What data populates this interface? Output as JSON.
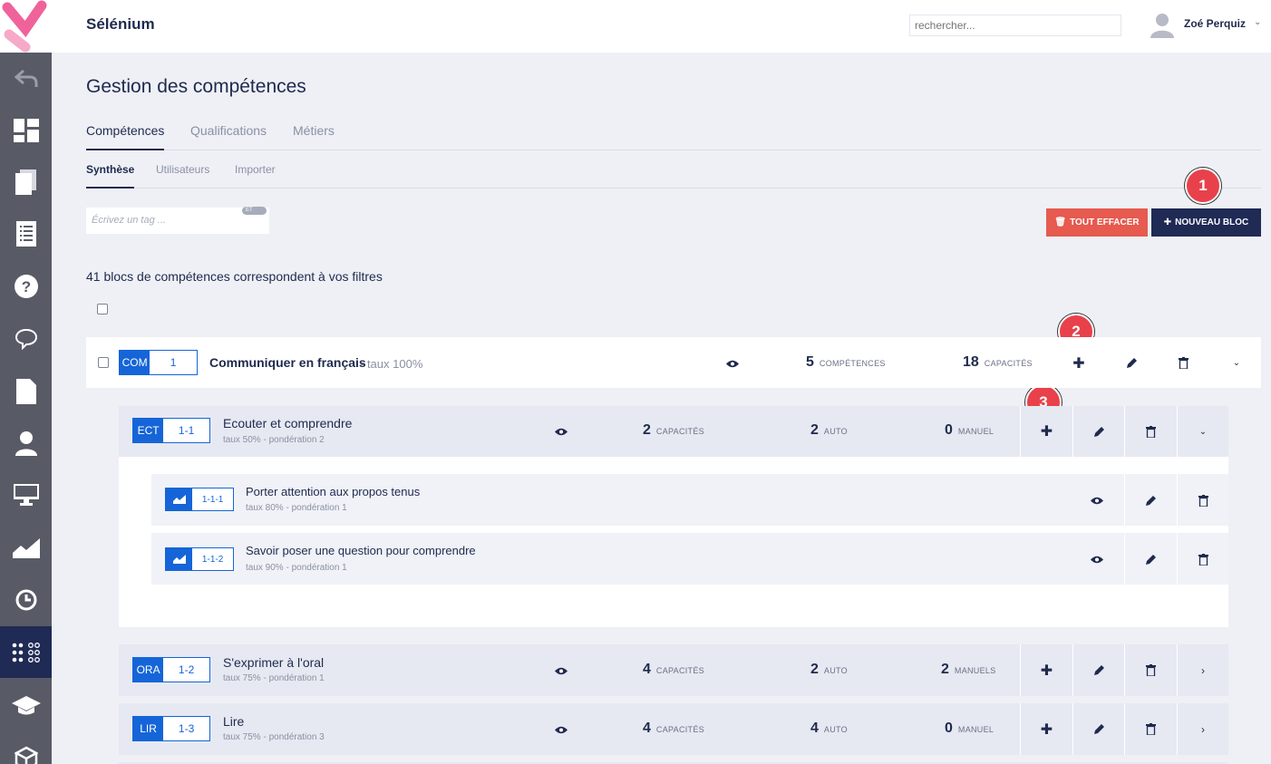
{
  "topbar": {
    "app_title": "Sélénium",
    "search_placeholder": "rechercher...",
    "user_name": "Zoé Perquiz"
  },
  "page": {
    "title": "Gestion des compétences"
  },
  "tabs": [
    {
      "label": "Compétences"
    },
    {
      "label": "Qualifications"
    },
    {
      "label": "Métiers"
    }
  ],
  "subtabs": [
    {
      "label": "Synthèse"
    },
    {
      "label": "Utilisateurs"
    },
    {
      "label": "Importer"
    }
  ],
  "filter": {
    "tag_placeholder": "Écrivez un tag ...",
    "toggle_label": "ET"
  },
  "buttons": {
    "clear": "TOUT EFFACER",
    "new_block": "NOUVEAU BLOC"
  },
  "callouts": [
    "1",
    "2",
    "3"
  ],
  "results_text": "41 blocs de compétences correspondent à vos filtres",
  "block": {
    "code": "COM",
    "number": "1",
    "title": "Communiquer en français",
    "rate": "- taux 100%",
    "competences_count": "5",
    "competences_label": "COMPÉTENCES",
    "capacites_count": "18",
    "capacites_label": "CAPACITÉS"
  },
  "competences": [
    {
      "code": "ECT",
      "number": "1-1",
      "title": "Ecouter et comprendre",
      "meta": "taux 50% - pondération 2",
      "cap": "2",
      "cap_label": "CAPACITÉS",
      "auto": "2",
      "auto_label": "AUTO",
      "manuel": "0",
      "manuel_label": "MANUEL"
    },
    {
      "code": "ORA",
      "number": "1-2",
      "title": "S'exprimer à l'oral",
      "meta": "taux 75% - pondération 1",
      "cap": "4",
      "cap_label": "CAPACITÉS",
      "auto": "2",
      "auto_label": "AUTO",
      "manuel": "2",
      "manuel_label": "MANUELS"
    },
    {
      "code": "LIR",
      "number": "1-3",
      "title": "Lire",
      "meta": "taux 75% - pondération 3",
      "cap": "4",
      "cap_label": "CAPACITÉS",
      "auto": "4",
      "auto_label": "AUTO",
      "manuel": "0",
      "manuel_label": "MANUEL"
    }
  ],
  "capacites": [
    {
      "number": "1-1-1",
      "title": "Porter attention aux propos tenus",
      "meta": "taux 80% - pondération 1"
    },
    {
      "number": "1-1-2",
      "title": "Savoir poser une question pour comprendre",
      "meta": "taux 90% - pondération 1"
    }
  ],
  "colors": {
    "primary": "#1f2a55",
    "accent_blue": "#1565d8",
    "danger": "#e65a4f",
    "callout": "#e8414b"
  }
}
